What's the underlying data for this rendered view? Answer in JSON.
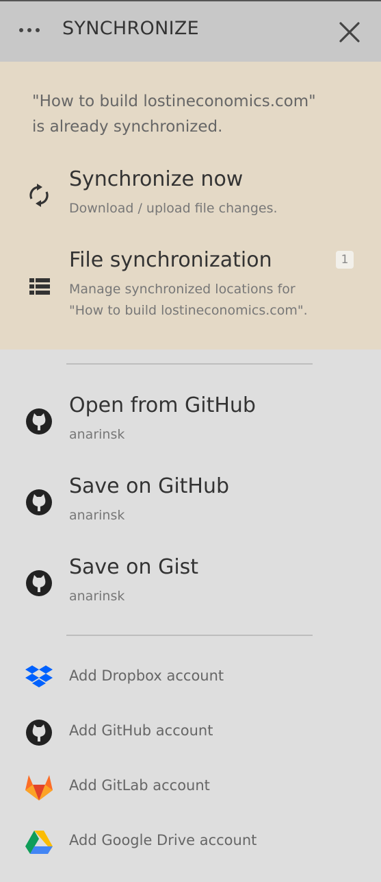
{
  "header": {
    "title": "SYNCHRONIZE",
    "menu_icon": "more-dots-icon",
    "close_icon": "close-icon"
  },
  "info": {
    "line1": "\"How to build lostineconomics.com\"",
    "line2": "is already synchronized.",
    "background": "#e4d9c6"
  },
  "items": {
    "sync_now": {
      "title": "Synchronize now",
      "subtitle": "Download / upload file changes.",
      "icon": "sync-icon"
    },
    "file_sync": {
      "title": "File synchronization",
      "subtitle_line1": "Manage synchronized locations for",
      "subtitle_line2": "\"How to build lostineconomics.com\".",
      "badge": "1",
      "icon": "list-icon"
    },
    "open_github": {
      "title": "Open from GitHub",
      "subtitle": "anarinsk",
      "icon": "github-icon"
    },
    "save_github": {
      "title": "Save on GitHub",
      "subtitle": "anarinsk",
      "icon": "github-icon"
    },
    "save_gist": {
      "title": "Save on Gist",
      "subtitle": "anarinsk",
      "icon": "github-icon"
    }
  },
  "accounts": [
    {
      "label": "Add Dropbox account",
      "icon": "dropbox-icon"
    },
    {
      "label": "Add GitHub account",
      "icon": "github-icon"
    },
    {
      "label": "Add GitLab account",
      "icon": "gitlab-icon"
    },
    {
      "label": "Add Google Drive account",
      "icon": "google-drive-icon"
    }
  ],
  "colors": {
    "header_bg": "#c8c8c8",
    "panel_bg": "#dedede",
    "dropbox": "#0061fe",
    "gitlab": "#fc6d26"
  }
}
